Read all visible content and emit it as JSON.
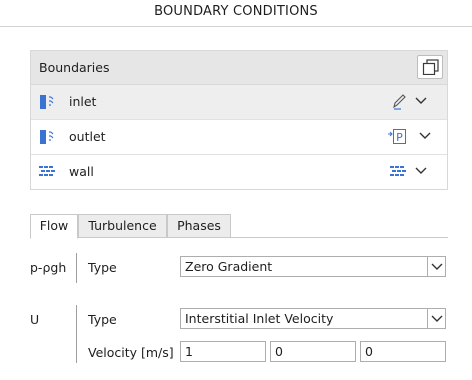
{
  "title": "BOUNDARY CONDITIONS",
  "boundaries": {
    "header": "Boundaries",
    "copy_icon": "copy-icon",
    "rows": [
      {
        "name": "inlet",
        "type_icon": "patch-icon",
        "action_icon": "pencil-icon",
        "expand_icon": "chevron-down-icon"
      },
      {
        "name": "outlet",
        "type_icon": "patch-icon",
        "action_icon": "pressure-outlet-icon",
        "action_text": "P",
        "expand_icon": "chevron-down-icon"
      },
      {
        "name": "wall",
        "type_icon": "wall-icon",
        "action_icon": "wall-icon",
        "expand_icon": "chevron-down-icon"
      }
    ]
  },
  "tabs": [
    {
      "label": "Flow",
      "active": true
    },
    {
      "label": "Turbulence",
      "active": false
    },
    {
      "label": "Phases",
      "active": false
    }
  ],
  "fields": {
    "p_rgh": {
      "name": "p-ρgh",
      "type_label": "Type",
      "type_value": "Zero Gradient"
    },
    "U": {
      "name": "U",
      "type_label": "Type",
      "type_value": "Interstitial Inlet Velocity",
      "velocity_label": "Velocity [m/s]",
      "velocity_values": [
        "1",
        "0",
        "0"
      ]
    }
  },
  "colors": {
    "accent_blue": "#3a73d1",
    "header_gray": "#e6e6e6",
    "selected_row": "#eeeeee"
  }
}
